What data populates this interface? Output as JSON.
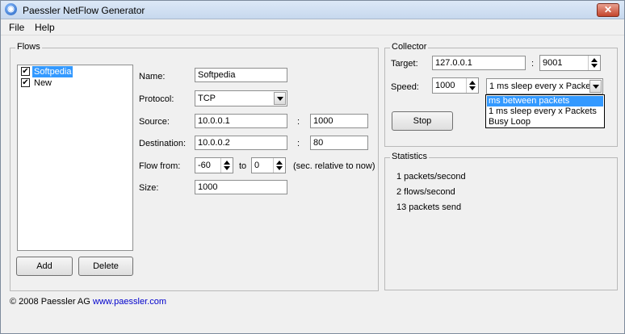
{
  "window": {
    "title": "Paessler NetFlow Generator",
    "icon": "app-logo-icon",
    "close_glyph": "✕"
  },
  "menu": {
    "items": [
      "File",
      "Help"
    ]
  },
  "flows": {
    "legend": "Flows",
    "list": [
      {
        "label": "Softpedia",
        "checked": true,
        "selected": true
      },
      {
        "label": "New",
        "checked": true,
        "selected": false
      }
    ],
    "check_glyph": "✔",
    "name_label": "Name:",
    "name_value": "Softpedia",
    "protocol_label": "Protocol:",
    "protocol_value": "TCP",
    "source_label": "Source:",
    "source_ip": "10.0.0.1",
    "source_port": "1000",
    "destination_label": "Destination:",
    "destination_ip": "10.0.0.2",
    "destination_port": "80",
    "separator": ":",
    "flow_from_label": "Flow from:",
    "flow_from_value": "-60",
    "to_label": "to",
    "flow_to_value": "0",
    "relative_note": "(sec. relative to now)",
    "size_label": "Size:",
    "size_value": "1000",
    "add_button": "Add",
    "delete_button": "Delete"
  },
  "collector": {
    "legend": "Collector",
    "target_label": "Target:",
    "target_ip": "127.0.0.1",
    "separator": ":",
    "target_port": "9001",
    "speed_label": "Speed:",
    "speed_value": "1000",
    "speed_mode_value": "1 ms sleep every x Packe",
    "speed_mode_options": [
      "ms between packets",
      "1 ms sleep every x Packets",
      "Busy Loop"
    ],
    "stop_button": "Stop"
  },
  "statistics": {
    "legend": "Statistics",
    "lines": [
      "1 packets/second",
      "2 flows/second",
      "13 packets send"
    ]
  },
  "footer": {
    "copyright": "© 2008 Paessler AG",
    "link": "www.paessler.com"
  }
}
